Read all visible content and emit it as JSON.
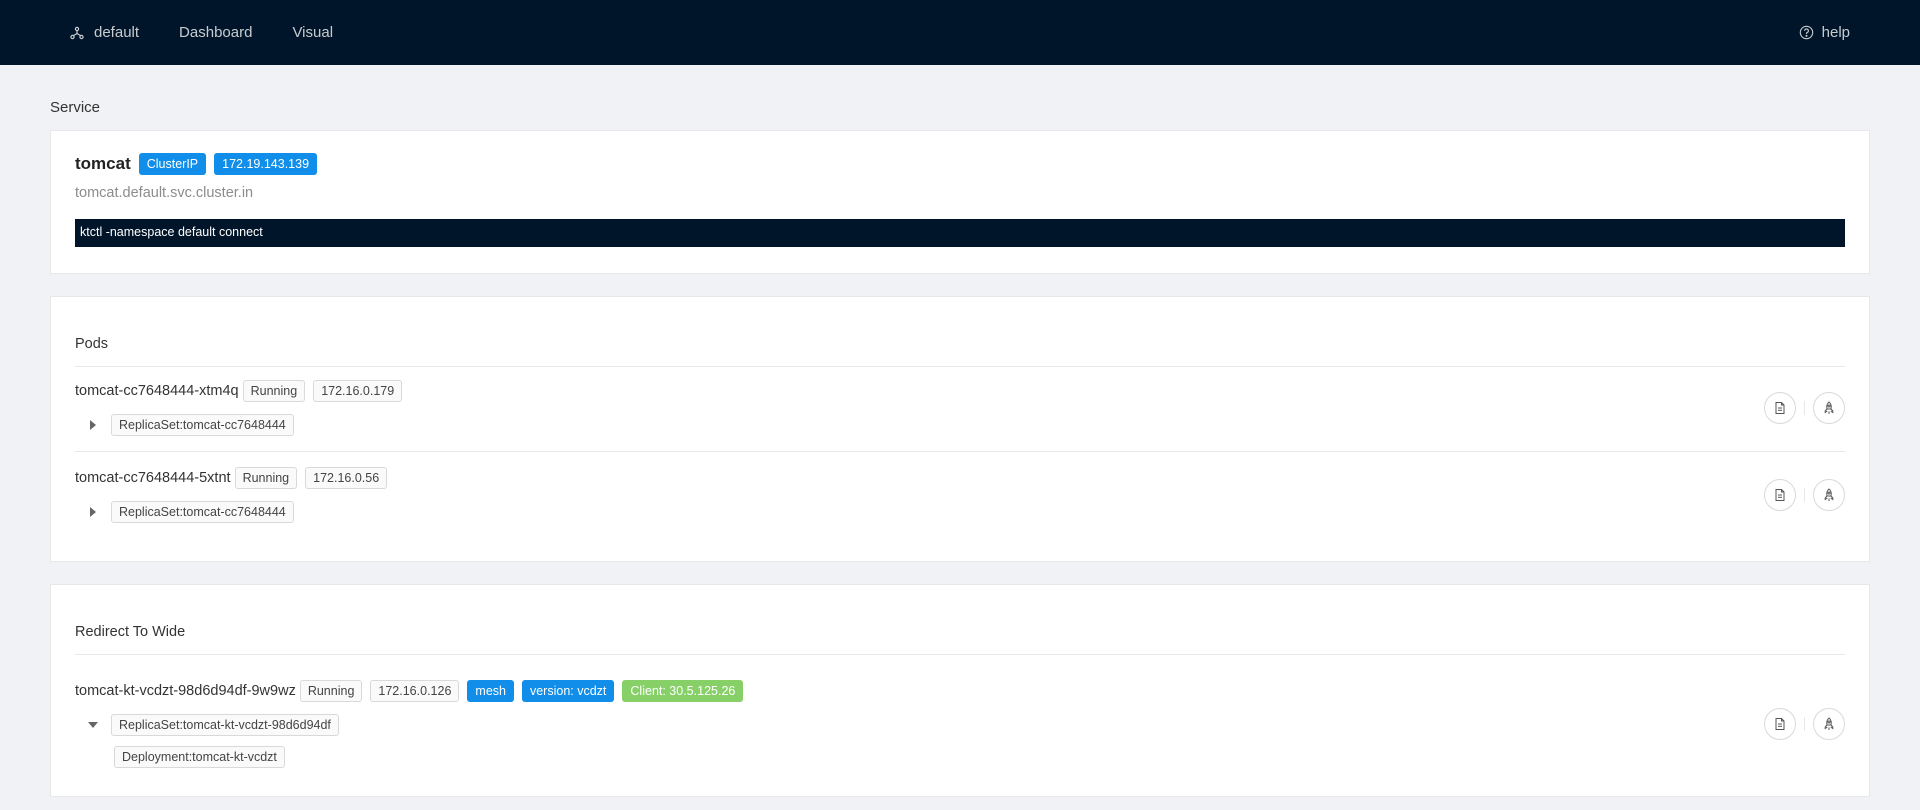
{
  "nav": {
    "namespace": "default",
    "dashboard": "Dashboard",
    "visual": "Visual",
    "help": "help"
  },
  "service_section": {
    "label": "Service"
  },
  "service": {
    "name": "tomcat",
    "type": "ClusterIP",
    "ip": "172.19.143.139",
    "dns": "tomcat.default.svc.cluster.in",
    "command": "ktctl -namespace default connect"
  },
  "pods": {
    "title": "Pods",
    "items": [
      {
        "name": "tomcat-cc7648444-xtm4q",
        "status": "Running",
        "ip": "172.16.0.179",
        "replicaset": "ReplicaSet:tomcat-cc7648444"
      },
      {
        "name": "tomcat-cc7648444-5xtnt",
        "status": "Running",
        "ip": "172.16.0.56",
        "replicaset": "ReplicaSet:tomcat-cc7648444"
      }
    ]
  },
  "redirect": {
    "title": "Redirect To Wide",
    "item": {
      "name": "tomcat-kt-vcdzt-98d6d94df-9w9wz",
      "status": "Running",
      "ip": "172.16.0.126",
      "mesh": "mesh",
      "version": "version: vcdzt",
      "client": "Client: 30.5.125.26",
      "replicaset": "ReplicaSet:tomcat-kt-vcdzt-98d6d94df",
      "deployment": "Deployment:tomcat-kt-vcdzt"
    }
  },
  "icons": {
    "namespace": "cluster-icon",
    "help": "question-circle-icon",
    "log": "file-text-icon",
    "exec": "rocket-icon",
    "expand": "caret-right-icon",
    "collapse": "caret-down-icon"
  },
  "colors": {
    "nav_bg": "#001529",
    "accent_blue": "#108ee9",
    "client_green": "#87d068",
    "page_bg": "#f0f2f5"
  }
}
